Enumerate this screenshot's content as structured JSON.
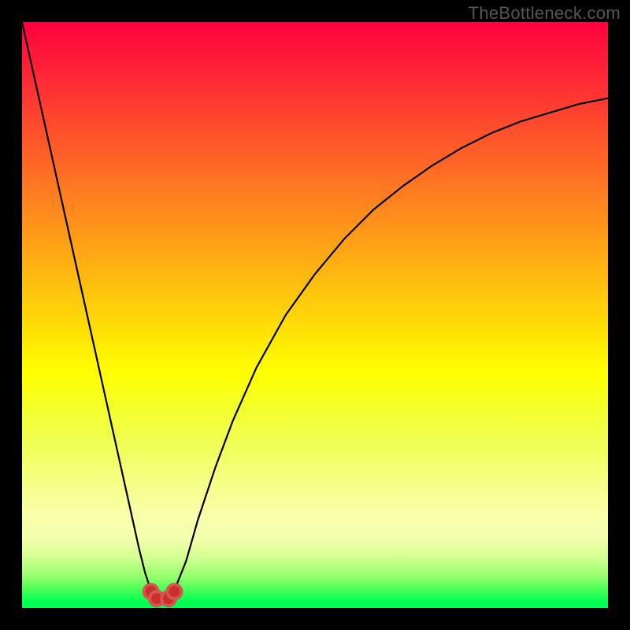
{
  "watermark": "TheBottleneck.com",
  "colors": {
    "frame": "#000000",
    "curve_stroke": "#000000",
    "marker_fill": "#d9534f",
    "marker_stroke": "#c9302c"
  },
  "chart_data": {
    "type": "line",
    "title": "",
    "xlabel": "",
    "ylabel": "",
    "xlim": [
      0,
      100
    ],
    "ylim": [
      0,
      100
    ],
    "grid": false,
    "legend": false,
    "series": [
      {
        "name": "curve",
        "x": [
          0,
          2,
          4,
          6,
          8,
          10,
          12,
          14,
          16,
          18,
          20,
          21,
          22,
          23,
          24,
          25,
          26,
          28,
          30,
          33,
          36,
          40,
          45,
          50,
          55,
          60,
          65,
          70,
          75,
          80,
          85,
          90,
          95,
          100
        ],
        "y": [
          100,
          91,
          82,
          73,
          64,
          55,
          46,
          37,
          28,
          19,
          10,
          6,
          3,
          1.5,
          1.2,
          1.5,
          3,
          8,
          15,
          24,
          32,
          41,
          50,
          57,
          63,
          68,
          72,
          75.5,
          78.5,
          81,
          83,
          84.5,
          86,
          87
        ]
      }
    ],
    "markers": [
      {
        "x": 22,
        "y": 2.8
      },
      {
        "x": 23,
        "y": 1.6
      },
      {
        "x": 25,
        "y": 1.6
      },
      {
        "x": 26,
        "y": 2.8
      }
    ]
  }
}
